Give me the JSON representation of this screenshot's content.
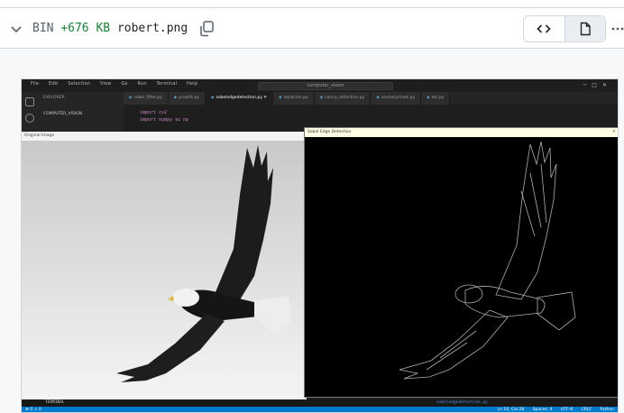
{
  "file_header": {
    "type_label": "BIN",
    "size_change": "+676 KB",
    "filename": "robert.png"
  },
  "colors": {
    "added": "#1a7f37",
    "vscode_status": "#007acc",
    "vscode_bg": "#1e1e1e"
  },
  "icons": {
    "collapse": "chevron-down-icon",
    "copy": "copy-icon",
    "code_view": "code-icon",
    "rich_view": "file-icon",
    "more": "kebab-horizontal-icon"
  },
  "screenshot": {
    "menu": [
      "File",
      "Edit",
      "Selection",
      "View",
      "Go",
      "Run",
      "Terminal",
      "Help"
    ],
    "search_text": "computer_vision",
    "sidebar": {
      "header": "EXPLORER",
      "folder": "COMPUTER_VISION"
    },
    "tabs": [
      "sobel_filter.py",
      "prewitt.py",
      "sobeledgedetection.py",
      "laplacian.py",
      "canny_detection.py",
      "unsharpmask.py",
      "tes.py"
    ],
    "active_tab_index": 2,
    "code_lines": [
      "import cv2",
      "import numpy as np"
    ],
    "original_window_title": "Original Image",
    "sobel_window_title": "Sobel Edge Detection",
    "terminal_label": "TERMINAL",
    "terminal_path": "sobeledgedetection.py",
    "status_items": [
      "Ln 10, Col 28",
      "Spaces: 4",
      "UTF-8",
      "CRLF",
      "Python"
    ]
  }
}
